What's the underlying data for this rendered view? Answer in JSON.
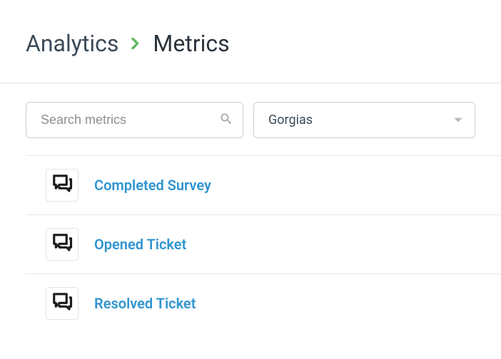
{
  "breadcrumb": {
    "root": "Analytics",
    "current": "Metrics"
  },
  "search": {
    "placeholder": "Search metrics",
    "value": ""
  },
  "source_dropdown": {
    "selected": "Gorgias"
  },
  "metrics": [
    {
      "label": "Completed Survey"
    },
    {
      "label": "Opened Ticket"
    },
    {
      "label": "Resolved Ticket"
    }
  ]
}
